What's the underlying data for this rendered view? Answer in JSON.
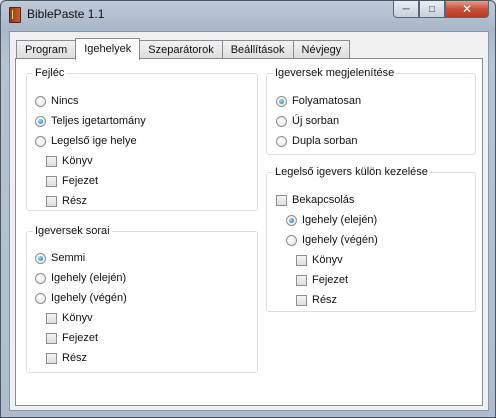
{
  "window": {
    "title": "BiblePaste 1.1"
  },
  "tabs": [
    "Program",
    "Igehelyek",
    "Szeparátorok",
    "Beállítások",
    "Névjegy"
  ],
  "fejlec": {
    "title": "Fejléc",
    "radios": [
      "Nincs",
      "Teljes igetartomány",
      "Legelső ige helye"
    ],
    "checks": [
      "Könyv",
      "Fejezet",
      "Rész"
    ]
  },
  "sorai": {
    "title": "Igeversek sorai",
    "radios": [
      "Semmi",
      "Igehely (elején)",
      "Igehely (végén)"
    ],
    "checks": [
      "Könyv",
      "Fejezet",
      "Rész"
    ]
  },
  "megjelenites": {
    "title": "Igeversek megjelenítése",
    "radios": [
      "Folyamatosan",
      "Új sorban",
      "Dupla sorban"
    ]
  },
  "legelso": {
    "title": "Legelső igevers külön kezelése",
    "bekapcsolas": "Bekapcsolás",
    "radios": [
      "Igehely (elején)",
      "Igehely (végén)"
    ],
    "checks": [
      "Könyv",
      "Fejezet",
      "Rész"
    ]
  }
}
